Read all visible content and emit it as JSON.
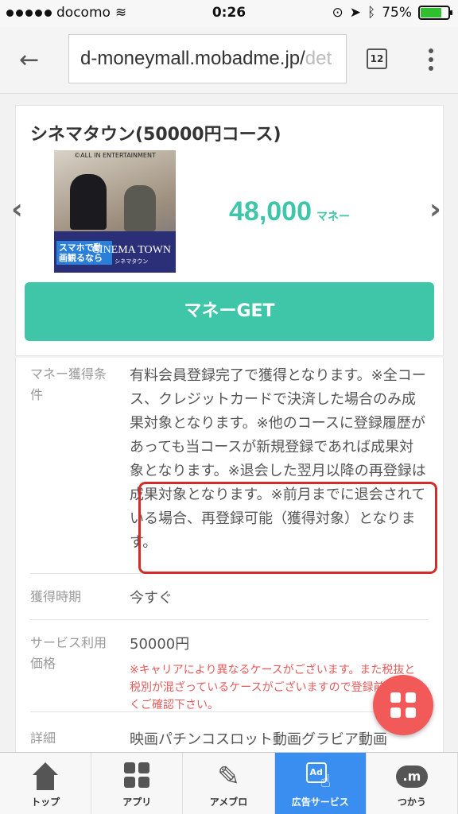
{
  "status_bar": {
    "carrier": "docomo",
    "time": "0:26",
    "battery": "75%",
    "battery_level": 0.75
  },
  "browser": {
    "url": "d-moneymall.mobadme.jp/",
    "url_faded": "det",
    "tab_count": "12"
  },
  "offer": {
    "title": "シネマタウン(50000円コース)",
    "banner_copyright": "©ALL IN ENTERTAINMENT",
    "banner_tagline": "スマホで動画観るなら",
    "banner_brand": "CINEMA TOWN",
    "banner_brand_kana": "シネマタウン",
    "amount": "48,000",
    "amount_unit": "マネー",
    "get_button": "マネーGET"
  },
  "details": [
    {
      "label": "マネー獲得条件",
      "value": "有料会員登録完了で獲得となります。※全コース、クレジットカードで決済した場合のみ成果対象となります。※他のコースに登録履歴があっても当コースが新規登録であれば成果対象となります。※退会した翌月以降の再登録は成果対象となります。※前月までに退会されている場合、再登録可能（獲得対象）となります。"
    },
    {
      "label": "獲得時期",
      "value": "今すぐ"
    },
    {
      "label": "サービス利用価格",
      "value": "50000円",
      "note": "※キャリアにより異なるケースがございます。また税抜と税別が混ざっているケースがございますので登録前によくご確認下さい。"
    },
    {
      "label": "詳細",
      "value": "映画パチンコスロット動画グラビア動画"
    }
  ],
  "nav": [
    {
      "label": "トップ",
      "icon": "home-icon"
    },
    {
      "label": "アプリ",
      "icon": "apps-icon"
    },
    {
      "label": "アメブロ",
      "icon": "pencil-icon"
    },
    {
      "label": "広告サービス",
      "icon": "ad-touch-icon"
    },
    {
      "label": "つかう",
      "icon": "money-coin-icon"
    }
  ],
  "colors": {
    "accent_green": "#3fc6a8",
    "nav_active": "#3a8ef0",
    "fab": "#f25a5a",
    "highlight_border": "#d52b2b",
    "note_red": "#e35c5c"
  }
}
